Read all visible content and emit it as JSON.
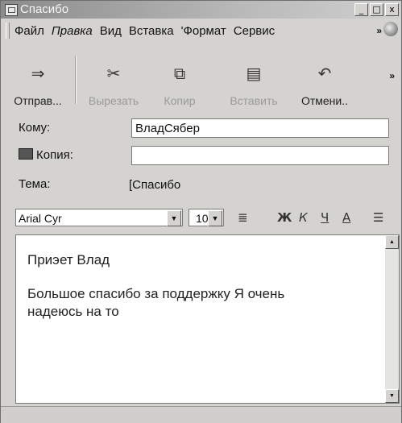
{
  "window": {
    "title": "Спасибо",
    "controls": [
      "_",
      "□",
      "x"
    ]
  },
  "menu": {
    "items": [
      "Файл",
      "Правка",
      "Вид",
      "Вставка",
      "'Формат",
      "Сервис"
    ],
    "overflow": "»"
  },
  "toolbar": {
    "buttons": [
      {
        "label": "Отправ...",
        "icon": "send-icon",
        "glyph": "⇒"
      },
      {
        "label": "Вырезать",
        "icon": "cut-icon",
        "glyph": "✂"
      },
      {
        "label": "Копир",
        "icon": "copy-icon",
        "glyph": "⧉"
      },
      {
        "label": "Вставить",
        "icon": "paste-icon",
        "glyph": "▤"
      },
      {
        "label": "Отмени..",
        "icon": "undo-icon",
        "glyph": "↶"
      }
    ],
    "overflow": "»"
  },
  "header": {
    "to_label": "Кому:",
    "to_value": "ВладСябер",
    "cc_label": "Копия:",
    "cc_value": "",
    "subject_label": "Тема:",
    "subject_value": "[Спасибо"
  },
  "format": {
    "font": "Arial Cyr",
    "size": "10",
    "buttons": [
      "Ж",
      "К",
      "Ч",
      "А"
    ]
  },
  "body": {
    "line1": "Приэет Влад",
    "line2": "Большое спасибо за поддержку Я очень",
    "line3": "надеюсь на то"
  }
}
